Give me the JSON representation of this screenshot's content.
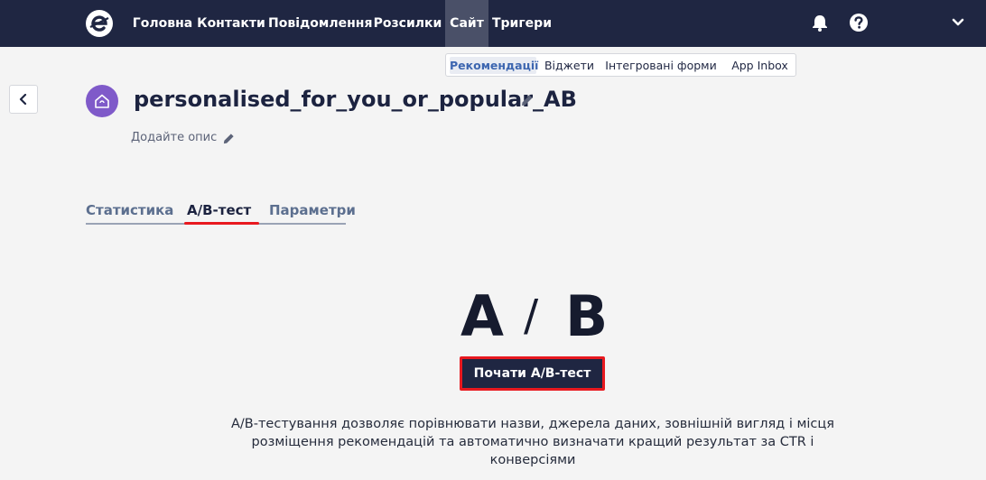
{
  "topnav": {
    "items": [
      {
        "label": "Головна",
        "active": false
      },
      {
        "label": "Контакти",
        "active": false
      },
      {
        "label": "Повідомлення",
        "active": false
      },
      {
        "label": "Розсилки",
        "active": false
      },
      {
        "label": "Сайт",
        "active": true
      },
      {
        "label": "Тригери",
        "active": false
      }
    ],
    "icons": [
      "logo-icon",
      "bell-icon",
      "help-icon",
      "chevron-down-icon"
    ]
  },
  "subnav": {
    "items": [
      {
        "label": "Рекомендації",
        "active": true
      },
      {
        "label": "Віджети",
        "active": false
      },
      {
        "label": "Інтегровані форми",
        "active": false
      },
      {
        "label": "App Inbox",
        "active": false
      }
    ]
  },
  "header": {
    "title": "personalised_for_you_or_popular_AB",
    "description_placeholder": "Додайте опис",
    "avatar_icon": "home-icon",
    "avatar_color": "#7f5ac9"
  },
  "tabs": [
    {
      "label": "Статистика",
      "active": false
    },
    {
      "label": "A/B-тест",
      "active": true
    },
    {
      "label": "Параметри",
      "active": false
    }
  ],
  "ab_section": {
    "letter_a": "A",
    "slash": "/",
    "letter_b": "B",
    "start_button": "Почати A/B-тест",
    "description_line1": "A/B-тестування дозволяє порівнювати назви, джерела даних, зовнішній вигляд і місця",
    "description_line2": "розміщення рекомендацій та автоматично визначати кращий результат за CTR і",
    "description_line3": "конверсіями"
  },
  "colors": {
    "topbar": "#1f2642",
    "active_nav": "#4a5068",
    "accent_red": "#e8191f",
    "background": "#f4f4f4"
  }
}
